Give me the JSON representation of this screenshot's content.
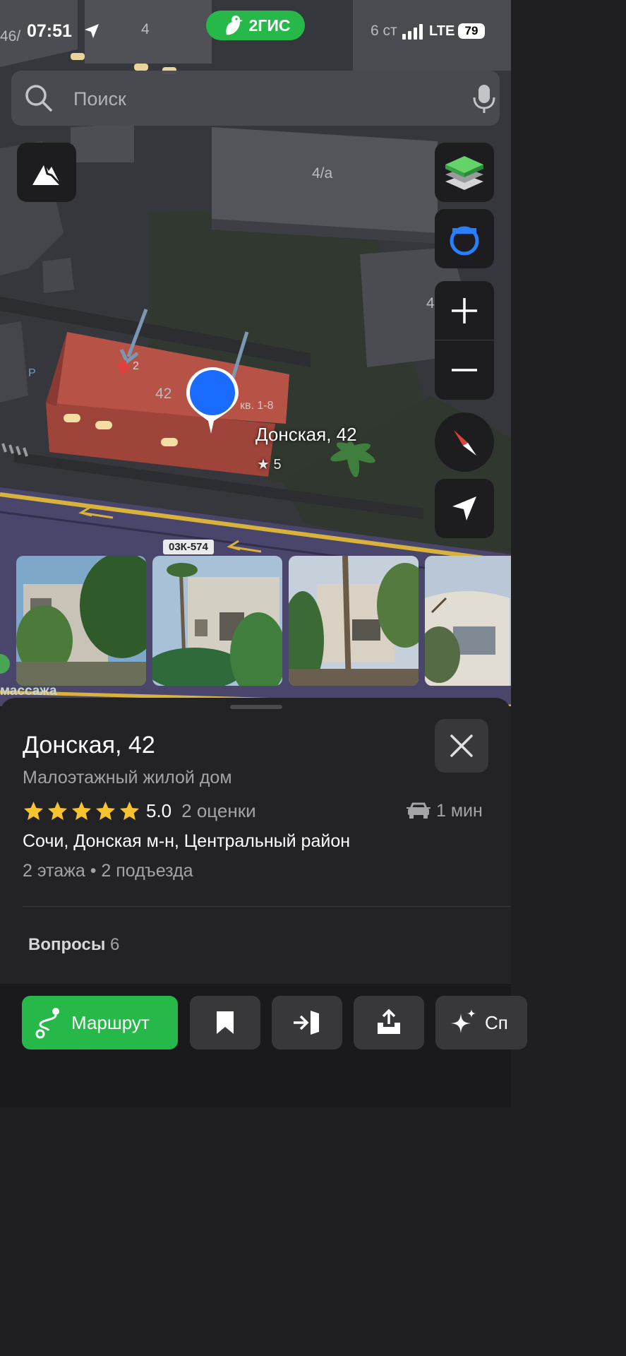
{
  "status_bar": {
    "time": "07:51",
    "brand": "2ГИС",
    "network": "LTE",
    "battery": "79"
  },
  "search": {
    "placeholder": "Поиск"
  },
  "map": {
    "building_labels": [
      "46/",
      "4",
      "6 ст",
      "4/а",
      "4",
      "42",
      "кв. 1-8",
      "2",
      "Р"
    ],
    "selected_building": {
      "name": "Донская, 42",
      "rating": "★ 5"
    },
    "road_tag": "03К-574",
    "road_name": "массажа",
    "icons": [
      "terrain-icon",
      "layers-icon",
      "route-widget-icon",
      "zoom-in-icon",
      "zoom-out-icon",
      "compass-icon",
      "my-location-icon"
    ]
  },
  "photos": [
    "photo-1",
    "photo-2",
    "photo-3",
    "photo-4"
  ],
  "place": {
    "title": "Донская, 42",
    "subtitle": "Малоэтажный жилой дом",
    "rating_value": "5.0",
    "rating_count": "2 оценки",
    "stars": 5,
    "drive_time": "1 мин",
    "address": "Сочи, Донская м-н, Центральный район",
    "floors": "2 этажа • 2 подъезда",
    "questions_label": "Вопросы",
    "questions_count": "6"
  },
  "actions": {
    "route_label": "Маршрут",
    "more_label": "Сп"
  },
  "colors": {
    "accent": "#27b84a",
    "star": "#f7c32e",
    "pin": "#1a6cff",
    "building_selected": "#a8473d"
  }
}
